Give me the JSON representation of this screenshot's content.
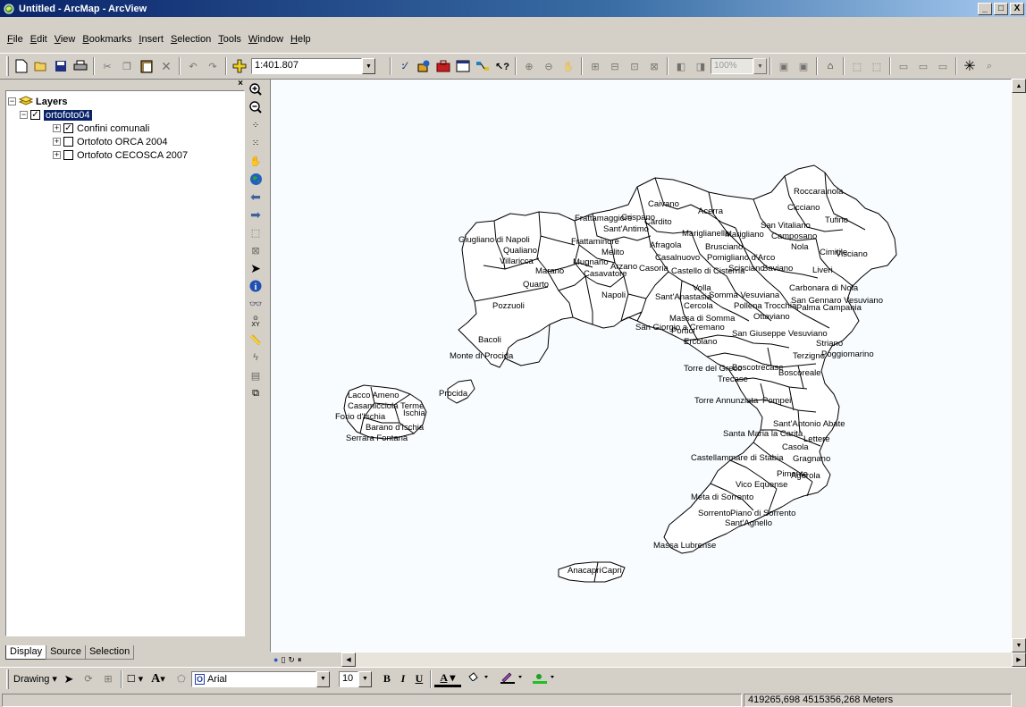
{
  "window": {
    "title": "Untitled - ArcMap - ArcView",
    "minimize": "_",
    "maximize": "□",
    "close": "X"
  },
  "menu": [
    {
      "label": "File",
      "mnemonic": "F",
      "rest": "ile"
    },
    {
      "label": "Edit",
      "mnemonic": "E",
      "rest": "dit"
    },
    {
      "label": "View",
      "mnemonic": "V",
      "rest": "iew"
    },
    {
      "label": "Bookmarks",
      "mnemonic": "B",
      "rest": "ookmarks"
    },
    {
      "label": "Insert",
      "mnemonic": "I",
      "rest": "nsert"
    },
    {
      "label": "Selection",
      "mnemonic": "S",
      "rest": "election"
    },
    {
      "label": "Tools",
      "mnemonic": "T",
      "rest": "ools"
    },
    {
      "label": "Window",
      "mnemonic": "W",
      "rest": "indow"
    },
    {
      "label": "Help",
      "mnemonic": "H",
      "rest": "elp"
    }
  ],
  "toolbar": {
    "scale": "1:401.807",
    "zoom_percent": "100%"
  },
  "toc": {
    "root_label": "Layers",
    "data_frame": "ortofoto04",
    "layers": [
      {
        "label": "Confini comunali",
        "checked": "✓"
      },
      {
        "label": "Ortofoto ORCA 2004",
        "checked": ""
      },
      {
        "label": "Ortofoto CECOSCA 2007",
        "checked": ""
      }
    ],
    "tabs": [
      "Display",
      "Source",
      "Selection"
    ],
    "close": "×"
  },
  "map": {
    "labels": [
      "Roccarainola",
      "Caivano",
      "Acerra",
      "Cicciano",
      "Tufino",
      "San Vitaliano",
      "Frattamaggiore",
      "Crispano",
      "Sant'Antimo",
      "Cardito",
      "Mariglianella",
      "Marigliano",
      "Camposano",
      "Giugliano di Napoli",
      "Frattaminore",
      "Afragola",
      "Brusciano",
      "Nola",
      "Cimitile",
      "Visciano",
      "Qualiano",
      "Melito",
      "Casalnuovo",
      "Pomigliano d'Arco",
      "Villaricca",
      "Mugnano",
      "Arzano",
      "Casoria",
      "Castello di Cisterna",
      "Scisciano",
      "Saviano",
      "Liveri",
      "Marano",
      "Casavatore",
      "Quarto",
      "Volla",
      "Carbonara di Nola",
      "Napoli",
      "Sant'Anastasia",
      "Somma Vesuviana",
      "San Gennaro Vesuviano",
      "Pozzuoli",
      "Cercola",
      "Pollena Trocchia",
      "Palma Campania",
      "Ottaviano",
      "Massa di Somma",
      "San Giorgio a Cremano",
      "Portici",
      "Ercolano",
      "San Giuseppe Vesuviano",
      "Striano",
      "Bacoli",
      "Terzigno",
      "Poggiomarino",
      "Monte di Procida",
      "Torre del Greco",
      "Boscotrecase",
      "Boscoreale",
      "Trecase",
      "Procida",
      "Lacco Ameno",
      "Casamicciola Terme",
      "Forio d'Ischia",
      "Ischia",
      "Barano d'Ischia",
      "Serrara Fontana",
      "Torre Annunziata",
      "Pompei",
      "Sant'Antonio Abate",
      "Santa Maria la Carità",
      "Lettere",
      "Casola",
      "Gragnano",
      "Castellammare di Stabia",
      "Pimonte",
      "Vico Equense",
      "Agerola",
      "Meta di Sorrento",
      "Sorrento",
      "Piano di Sorrento",
      "Sant'Agnello",
      "Massa Lubrense",
      "Anacapri",
      "Capri"
    ]
  },
  "drawing": {
    "label": "Drawing",
    "font": "Arial",
    "size": "10",
    "bold": "B",
    "italic": "I",
    "underline": "U",
    "font_color": "A"
  },
  "status": {
    "coords": "419265,698  4515356,268 Meters"
  }
}
